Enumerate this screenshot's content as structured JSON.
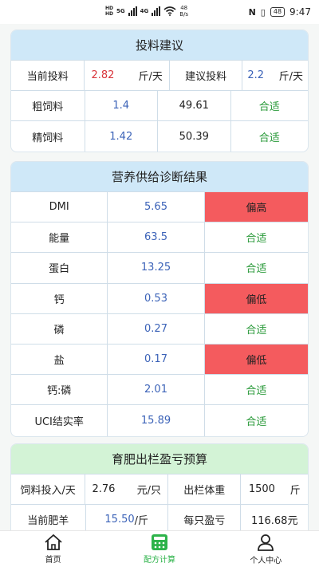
{
  "status_bar": {
    "sim1": "HD",
    "sim2": "HD",
    "net_type1": "5G",
    "net_type2": "4G",
    "speed_value": "48",
    "speed_unit": "B/s",
    "battery": "48",
    "time": "9:47"
  },
  "feeding": {
    "title": "投料建议",
    "current_label": "当前投料",
    "current_value": "2.82",
    "current_unit": "斤/天",
    "suggest_label": "建议投料",
    "suggest_value": "2.2",
    "suggest_unit": "斤/天",
    "rows": [
      {
        "name": "粗饲料",
        "value": "1.4",
        "ref": "49.61",
        "status": "合适"
      },
      {
        "name": "精饲料",
        "value": "1.42",
        "ref": "50.39",
        "status": "合适"
      }
    ]
  },
  "nutrition": {
    "title": "营养供给诊断结果",
    "rows": [
      {
        "name": "DMI",
        "value": "5.65",
        "status": "偏高"
      },
      {
        "name": "能量",
        "value": "63.5",
        "status": "合适"
      },
      {
        "name": "蛋白",
        "value": "13.25",
        "status": "合适"
      },
      {
        "name": "钙",
        "value": "0.53",
        "status": "偏低"
      },
      {
        "name": "磷",
        "value": "0.27",
        "status": "合适"
      },
      {
        "name": "盐",
        "value": "0.17",
        "status": "偏低"
      },
      {
        "name": "钙:磷",
        "value": "2.01",
        "status": "合适"
      },
      {
        "name": "UCI结实率",
        "value": "15.89",
        "status": "合适"
      }
    ]
  },
  "budget": {
    "title": "育肥出栏盈亏预算",
    "feed_cost_label": "饲料投入/天",
    "feed_cost_value": "2.76",
    "feed_cost_unit": "元/只",
    "out_weight_label": "出栏体重",
    "out_weight_value": "1500",
    "out_weight_unit": "斤",
    "current_sheep_label": "当前肥羊",
    "current_sheep_value": "15.50",
    "current_sheep_unit": "/斤",
    "profit_label": "每只盈亏",
    "profit_value": "116.68元"
  },
  "nav": {
    "home": "首页",
    "formula": "配方计算",
    "profile": "个人中心"
  },
  "colors": {
    "accent_green": "#2db34a",
    "bad_red": "#f45b5e",
    "ok_green": "#2a9a3a",
    "value_blue": "#3c63b8"
  }
}
